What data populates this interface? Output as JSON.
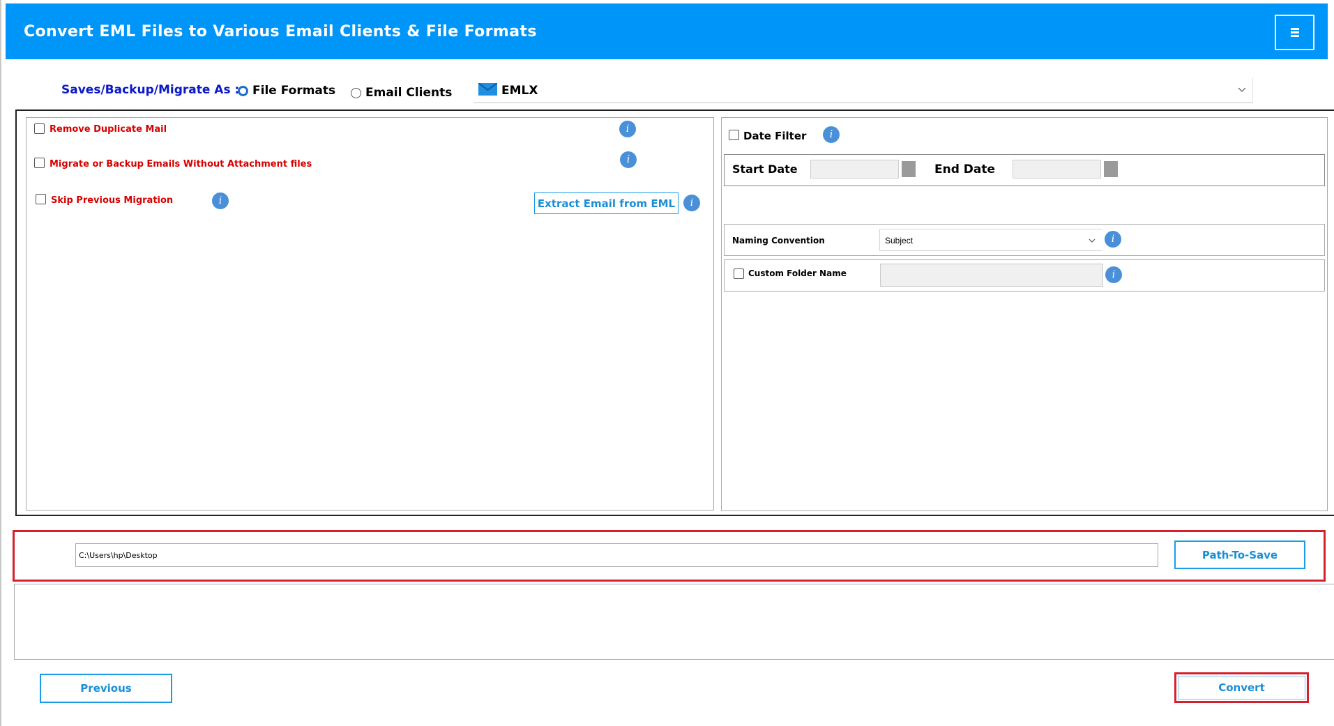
{
  "header": {
    "title": "Convert EML Files to Various Email Clients & File Formats",
    "menu_icon": "hamburger-icon"
  },
  "save_as": {
    "label": "Saves/Backup/Migrate As :",
    "options": [
      {
        "label": "File Formats",
        "selected": true
      },
      {
        "label": "Email Clients",
        "selected": false
      }
    ],
    "format_icon": "email-envelope-icon",
    "format_value": "EMLX"
  },
  "left_options": {
    "remove_duplicate": "Remove Duplicate Mail",
    "without_attachment": "Migrate or Backup Emails Without Attachment files",
    "skip_previous": "Skip Previous Migration",
    "extract_button": "Extract Email from EML"
  },
  "right_options": {
    "date_filter": "Date Filter",
    "start_date": "Start Date",
    "end_date": "End Date",
    "naming_convention": "Naming Convention",
    "naming_value": "Subject",
    "custom_folder": "Custom Folder Name"
  },
  "path": {
    "value": "C:\\Users\\hp\\Desktop",
    "button": "Path-To-Save"
  },
  "nav": {
    "previous": "Previous",
    "convert": "Convert"
  },
  "colors": {
    "header_bg": "#0095f8",
    "accent_blue": "#1a9be6",
    "highlight_red": "#d5212d",
    "option_red": "#d70000"
  }
}
